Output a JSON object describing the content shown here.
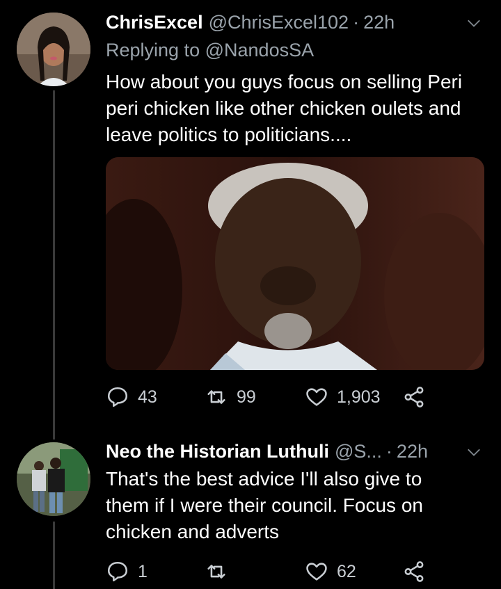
{
  "tweets": [
    {
      "display_name": "ChrisExcel",
      "handle": "@ChrisExcel102",
      "time": "22h",
      "reply_prefix": "Replying to",
      "reply_to": "@NandosSA",
      "text": "How about you guys focus on selling Peri peri chicken like other chicken oulets and leave politics to politicians....",
      "reply_count": "43",
      "retweet_count": "99",
      "like_count": "1,903"
    },
    {
      "display_name": "Neo the Historian Luthuli",
      "handle": "@S...",
      "time": "22h",
      "text": "That's the best advice I'll also give to them if I were their council. Focus on chicken and adverts",
      "reply_count": "1",
      "retweet_count": "",
      "like_count": "62"
    }
  ],
  "icons": {
    "reply": "reply-icon",
    "retweet": "retweet-icon",
    "like": "heart-icon",
    "share": "share-icon",
    "more": "chevron-down-icon"
  },
  "colors": {
    "background": "#000000",
    "text": "#ffffff",
    "muted": "#9aa3ab",
    "thread_line": "#3a3a3a"
  }
}
